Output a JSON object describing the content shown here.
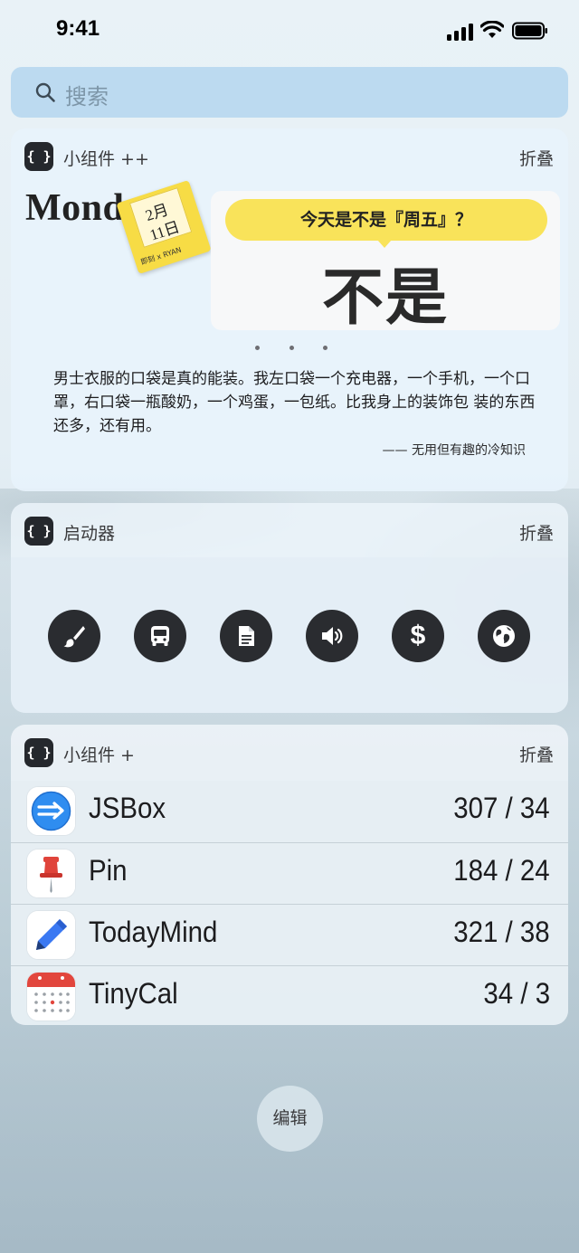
{
  "status_bar": {
    "time": "9:41"
  },
  "search": {
    "placeholder": "搜索"
  },
  "widgets": [
    {
      "title": "小组件 ++",
      "collapse_label": "折叠",
      "calendar": {
        "weekday": "Monda",
        "month": "2月",
        "day": "11日",
        "brand": "即刻 x RYAN"
      },
      "friday": {
        "question": "今天是不是『周五』？",
        "answer": "不是"
      },
      "trivia": {
        "text": "男士衣服的口袋是真的能装。我左口袋一个充电器，一个手机，一个口罩，右口袋一瓶酸奶，一个鸡蛋，一包纸。比我身上的装饰包 装的东西还多，还有用。",
        "source": "—— 无用但有趣的冷知识"
      }
    },
    {
      "title": "启动器",
      "collapse_label": "折叠",
      "launchers": [
        "paintbrush-icon",
        "bus-icon",
        "document-icon",
        "speaker-icon",
        "dollar-icon",
        "globe-icon"
      ]
    },
    {
      "title": "小组件 +",
      "collapse_label": "折叠",
      "apps": [
        {
          "name": "JSBox",
          "stats": "307 / 34",
          "icon": "jsbox-icon"
        },
        {
          "name": "Pin",
          "stats": "184 / 24",
          "icon": "pin-icon"
        },
        {
          "name": "TodayMind",
          "stats": "321 / 38",
          "icon": "todaymind-icon"
        },
        {
          "name": "TinyCal",
          "stats": "34 / 3",
          "icon": "tinycal-icon"
        }
      ]
    }
  ],
  "edit_label": "编辑",
  "colors": {
    "accent_yellow": "#f9e35a",
    "launcher_bg": "#2a2c30",
    "search_bg": "#b4d6ee"
  }
}
